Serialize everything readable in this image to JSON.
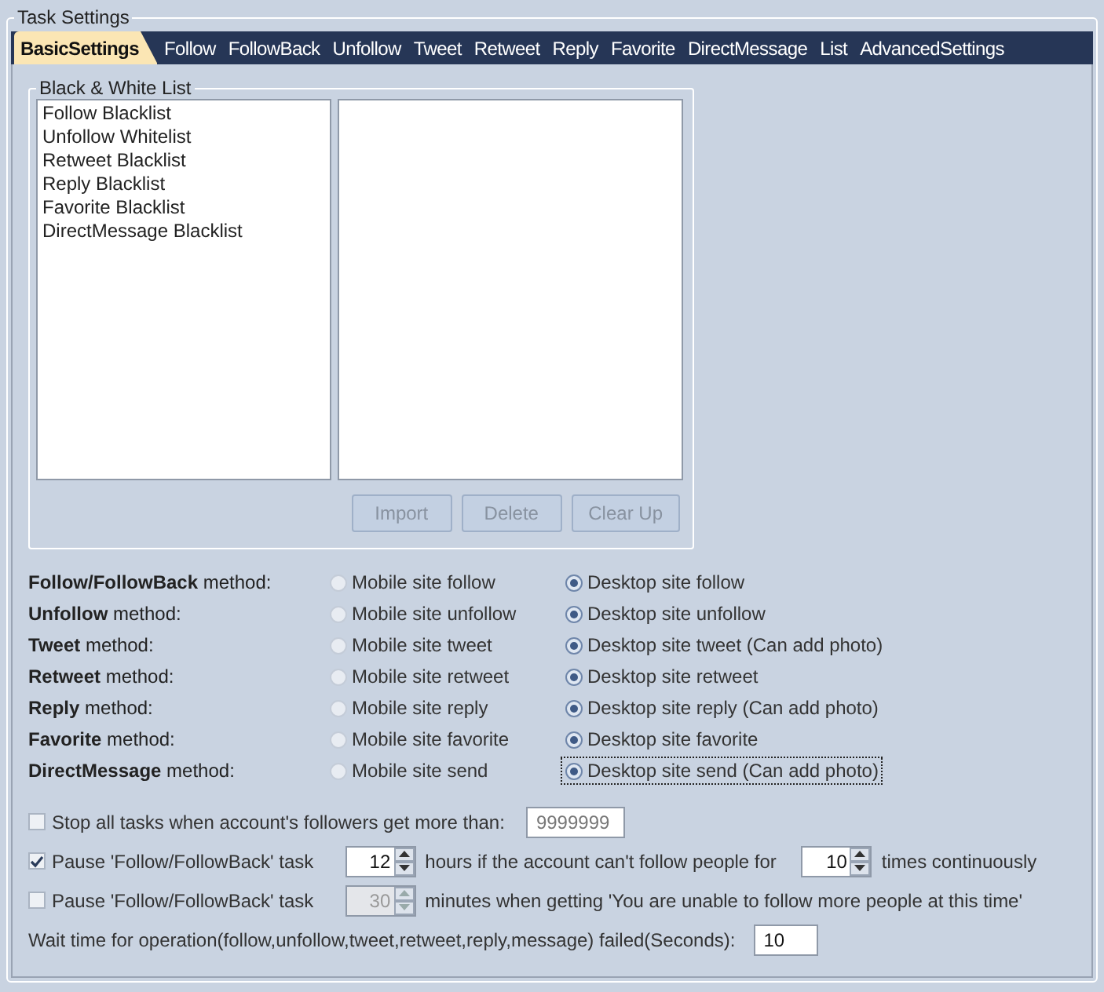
{
  "panel": {
    "title": "Task Settings"
  },
  "tabs": [
    {
      "label": "BasicSettings",
      "selected": true
    },
    {
      "label": "Follow",
      "selected": false
    },
    {
      "label": "FollowBack",
      "selected": false
    },
    {
      "label": "Unfollow",
      "selected": false
    },
    {
      "label": "Tweet",
      "selected": false
    },
    {
      "label": "Retweet",
      "selected": false
    },
    {
      "label": "Reply",
      "selected": false
    },
    {
      "label": "Favorite",
      "selected": false
    },
    {
      "label": "DirectMessage",
      "selected": false
    },
    {
      "label": "List",
      "selected": false
    },
    {
      "label": "AdvancedSettings",
      "selected": false
    }
  ],
  "black_white_list": {
    "title": "Black & White List",
    "lists": [
      {
        "label": "Follow Blacklist",
        "selected": false
      },
      {
        "label": "Unfollow Whitelist",
        "selected": false
      },
      {
        "label": "Retweet Blacklist",
        "selected": false
      },
      {
        "label": "Reply Blacklist",
        "selected": false
      },
      {
        "label": "Favorite Blacklist",
        "selected": false
      },
      {
        "label": "DirectMessage Blacklist",
        "selected": false
      }
    ],
    "buttons": [
      {
        "label": "Import",
        "disabled": true
      },
      {
        "label": "Delete",
        "disabled": true
      },
      {
        "label": "Clear Up",
        "disabled": true
      }
    ]
  },
  "methods": [
    {
      "label": "**Follow/FollowBack**  method:",
      "options": [
        {
          "label": "Mobile site follow",
          "selected": false,
          "focused": false
        },
        {
          "label": "Desktop site follow",
          "selected": true,
          "focused": false
        }
      ]
    },
    {
      "label": "**Unfollow**  method:",
      "options": [
        {
          "label": "Mobile site unfollow",
          "selected": false,
          "focused": false
        },
        {
          "label": "Desktop site unfollow",
          "selected": true,
          "focused": false
        }
      ]
    },
    {
      "label": "**Tweet** method:",
      "options": [
        {
          "label": "Mobile site tweet",
          "selected": false,
          "focused": false
        },
        {
          "label": "Desktop site tweet (Can add photo)",
          "selected": true,
          "focused": false
        }
      ]
    },
    {
      "label": "**Retweet** method:",
      "options": [
        {
          "label": "Mobile site retweet",
          "selected": false,
          "focused": false
        },
        {
          "label": "Desktop site retweet",
          "selected": true,
          "focused": false
        }
      ]
    },
    {
      "label": "**Reply** method:",
      "options": [
        {
          "label": "Mobile site reply",
          "selected": false,
          "focused": false
        },
        {
          "label": "Desktop site reply (Can add photo)",
          "selected": true,
          "focused": false
        }
      ]
    },
    {
      "label": "**Favorite** method:",
      "options": [
        {
          "label": "Mobile site favorite",
          "selected": false,
          "focused": false
        },
        {
          "label": "Desktop site favorite",
          "selected": true,
          "focused": false
        }
      ]
    },
    {
      "label": "**DirectMessage** method:",
      "options": [
        {
          "label": "Mobile site send",
          "selected": false,
          "focused": false
        },
        {
          "label": "Desktop site send (Can add photo)",
          "selected": true,
          "focused": true
        }
      ]
    }
  ],
  "settings": [
    {
      "kind": "stop",
      "checked": false,
      "label": "Stop all tasks when account's followers get more than:",
      "field": {
        "value": "9999999",
        "disabled": true
      }
    },
    {
      "kind": "pause_hours",
      "checked": true,
      "label": "Pause 'Follow/FollowBack' task",
      "spinner1": {
        "value": "12",
        "disabled": false
      },
      "text1": "hours if the account can't follow people for",
      "spinner2": {
        "value": "10",
        "disabled": false
      },
      "text2": "times continuously"
    },
    {
      "kind": "pause_minutes",
      "checked": false,
      "label": "Pause 'Follow/FollowBack' task",
      "spinner1": {
        "value": "30",
        "disabled": true
      },
      "text1": "minutes when getting 'You are unable to follow more people at this time'"
    },
    {
      "kind": "wait",
      "label": "Wait time for operation(follow,unfollow,tweet,retweet,reply,message) failed(Seconds):",
      "field": {
        "value": "10",
        "disabled": false
      }
    }
  ]
}
